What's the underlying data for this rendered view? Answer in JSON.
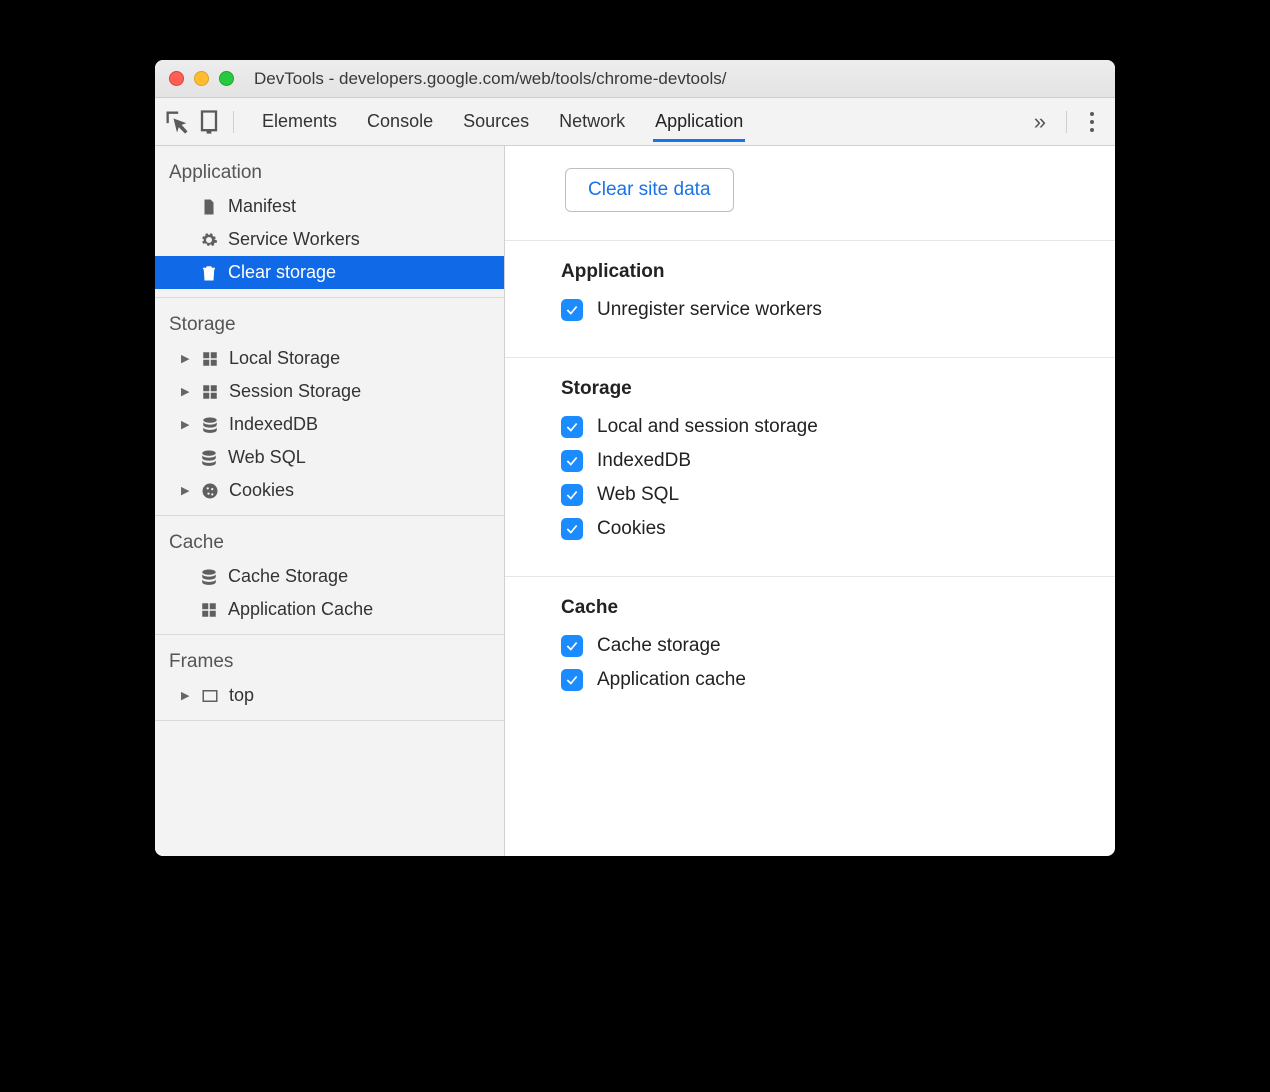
{
  "window_title": "DevTools - developers.google.com/web/tools/chrome-devtools/",
  "tabs": [
    "Elements",
    "Console",
    "Sources",
    "Network",
    "Application"
  ],
  "active_tab": "Application",
  "sidebar": {
    "groups": [
      {
        "title": "Application",
        "items": [
          {
            "icon": "file",
            "label": "Manifest",
            "disclosure": false,
            "selected": false
          },
          {
            "icon": "gear",
            "label": "Service Workers",
            "disclosure": false,
            "selected": false
          },
          {
            "icon": "trash",
            "label": "Clear storage",
            "disclosure": false,
            "selected": true
          }
        ]
      },
      {
        "title": "Storage",
        "items": [
          {
            "icon": "grid",
            "label": "Local Storage",
            "disclosure": true,
            "selected": false
          },
          {
            "icon": "grid",
            "label": "Session Storage",
            "disclosure": true,
            "selected": false
          },
          {
            "icon": "db",
            "label": "IndexedDB",
            "disclosure": true,
            "selected": false
          },
          {
            "icon": "db",
            "label": "Web SQL",
            "disclosure": false,
            "selected": false
          },
          {
            "icon": "cookie",
            "label": "Cookies",
            "disclosure": true,
            "selected": false
          }
        ]
      },
      {
        "title": "Cache",
        "items": [
          {
            "icon": "db",
            "label": "Cache Storage",
            "disclosure": false,
            "selected": false
          },
          {
            "icon": "grid",
            "label": "Application Cache",
            "disclosure": false,
            "selected": false
          }
        ]
      },
      {
        "title": "Frames",
        "items": [
          {
            "icon": "frame",
            "label": "top",
            "disclosure": true,
            "selected": false
          }
        ]
      }
    ]
  },
  "main": {
    "clear_button": "Clear site data",
    "sections": [
      {
        "title": "Application",
        "checks": [
          {
            "label": "Unregister service workers",
            "checked": true
          }
        ]
      },
      {
        "title": "Storage",
        "checks": [
          {
            "label": "Local and session storage",
            "checked": true
          },
          {
            "label": "IndexedDB",
            "checked": true
          },
          {
            "label": "Web SQL",
            "checked": true
          },
          {
            "label": "Cookies",
            "checked": true
          }
        ]
      },
      {
        "title": "Cache",
        "checks": [
          {
            "label": "Cache storage",
            "checked": true
          },
          {
            "label": "Application cache",
            "checked": true
          }
        ]
      }
    ]
  }
}
